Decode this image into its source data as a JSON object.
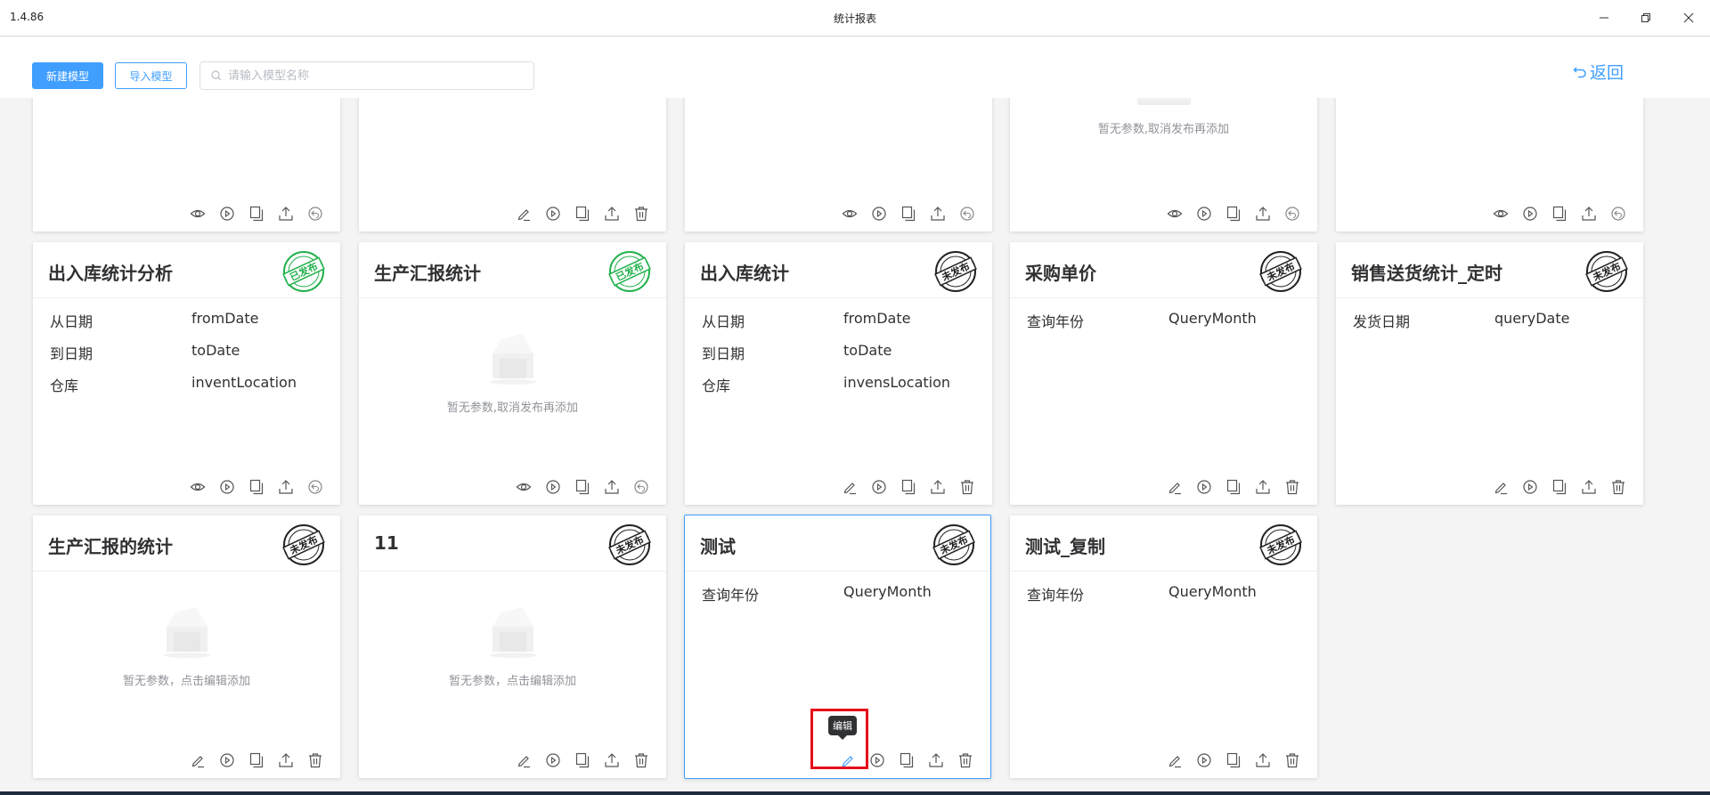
{
  "window": {
    "version": "1.4.86",
    "title": "统计报表"
  },
  "toolbar": {
    "new_model_label": "新建模型",
    "import_model_label": "导入模型",
    "search_placeholder": "请输入模型名称",
    "search_value": "",
    "back_label": "返回"
  },
  "top_row": {
    "empty_text": "暂无参数,取消发布再添加",
    "actions_published": [
      "view-icon",
      "run-icon",
      "copy-icon",
      "export-icon",
      "revoke-icon"
    ],
    "actions_unpublished": [
      "edit-icon",
      "run-icon",
      "copy-icon",
      "export-icon",
      "delete-icon"
    ]
  },
  "cards": [
    {
      "title": "出入库统计分析",
      "status": "已发布",
      "params": [
        {
          "label": "从日期",
          "value": "fromDate"
        },
        {
          "label": "到日期",
          "value": "toDate"
        },
        {
          "label": "仓库",
          "value": "inventLocation"
        }
      ]
    },
    {
      "title": "生产汇报统计",
      "status": "已发布",
      "empty_text": "暂无参数,取消发布再添加"
    },
    {
      "title": "出入库统计",
      "status": "未发布",
      "params": [
        {
          "label": "从日期",
          "value": "fromDate"
        },
        {
          "label": "到日期",
          "value": "toDate"
        },
        {
          "label": "仓库",
          "value": "invensLocation"
        }
      ]
    },
    {
      "title": "采购单价",
      "status": "未发布",
      "params": [
        {
          "label": "查询年份",
          "value": "QueryMonth"
        }
      ]
    },
    {
      "title": "销售送货统计_定时",
      "status": "未发布",
      "params": [
        {
          "label": "发货日期",
          "value": "queryDate"
        }
      ]
    },
    {
      "title": "生产汇报的统计",
      "status": "未发布",
      "empty_text": "暂无参数，点击编辑添加"
    },
    {
      "title": "11",
      "status": "未发布",
      "empty_text": "暂无参数，点击编辑添加"
    },
    {
      "title": "测试",
      "status": "未发布",
      "params": [
        {
          "label": "查询年份",
          "value": "QueryMonth"
        }
      ],
      "tooltip": "编辑"
    },
    {
      "title": "测试_复制",
      "status": "未发布",
      "params": [
        {
          "label": "查询年份",
          "value": "QueryMonth"
        }
      ]
    }
  ],
  "colors": {
    "primary": "#409eff",
    "published": "#22b14c",
    "unpublished": "#222222",
    "highlight": "#e5101b"
  }
}
